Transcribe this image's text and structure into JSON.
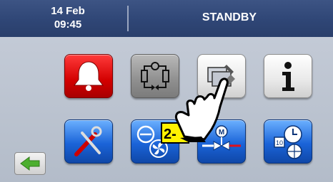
{
  "header": {
    "date": "14 Feb",
    "time": "09:45",
    "status": "STANDBY"
  },
  "callout": {
    "label": "2-"
  },
  "icons": {
    "alarm": "bell-icon",
    "circuit": "refrigeration-circuit-icon",
    "service": "service-tools-icon",
    "info": "info-icon",
    "settings": "settings-tools-icon",
    "fans": "compressor-fan-icon",
    "valve": "motor-valve-icon",
    "clock": "clock-calendar-globe-icon",
    "back": "back-arrow-icon"
  },
  "colors": {
    "header": "#2f4676",
    "alarm": "#d30000",
    "blue_tile": "#1b64d8",
    "callout": "#fff200",
    "back_arrow": "#4caf2f"
  }
}
